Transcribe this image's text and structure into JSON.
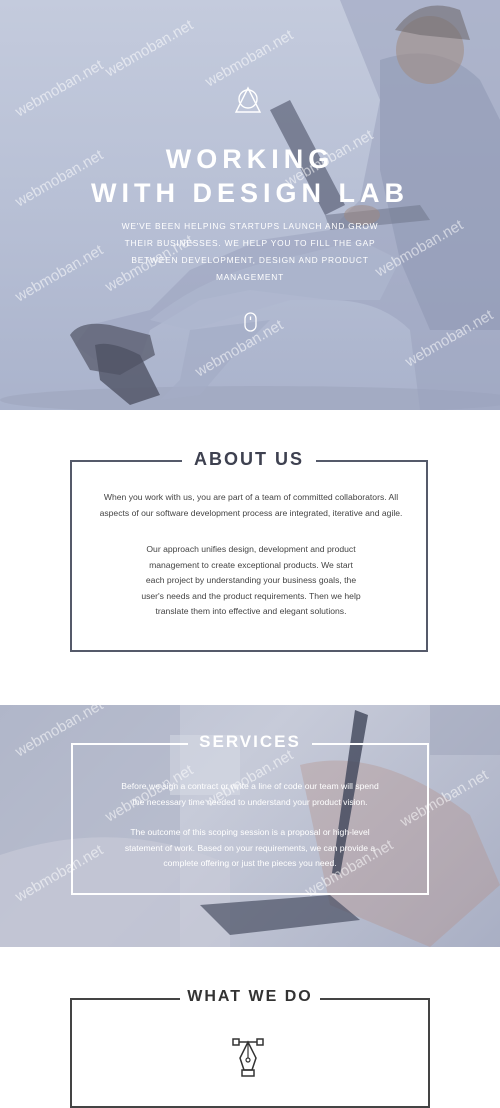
{
  "hero": {
    "title_line1": "WORKING",
    "title_line2": "WITH DESIGN LAB",
    "text": "We've been helping startups launch and grow their businesses. We help you to fill the gap between development, design and product management",
    "logo_icon": "triangle-circle-logo-icon",
    "scroll_icon": "mouse-scroll-icon"
  },
  "about": {
    "title": "ABOUT US",
    "paragraph1": "When you work with us, you are part of a team of committed collaborators. All aspects of our software development process are integrated, iterative and agile.",
    "paragraph2": "Our approach unifies design, development and product management to create exceptional products. We start each project by understanding your business goals, the user's needs and the product requirements. Then we help translate them into effective and elegant solutions."
  },
  "services": {
    "title": "SERVICES",
    "paragraph1": "Before we sign a contract or write a line of code our team will spend the necessary time needed to understand your product vision.",
    "paragraph2": "The outcome of this scoping session is a proposal or high-level statement of work. Based on your requirements, we can provide a complete offering or just the pieces you need."
  },
  "what_we_do": {
    "title": "WHAT WE DO",
    "icon": "pen-tool-icon"
  },
  "watermark": "webmoban.net"
}
